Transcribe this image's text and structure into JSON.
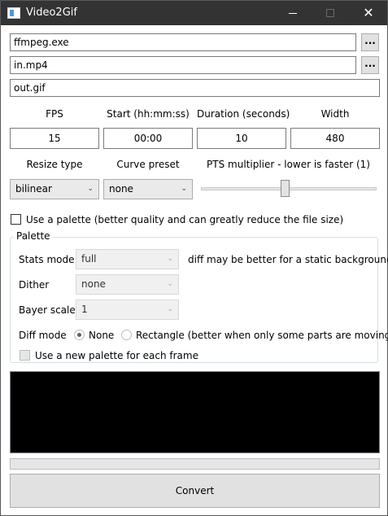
{
  "window": {
    "title": "Video2Gif",
    "minimize_glyph": "",
    "maximize_glyph": "",
    "close_glyph": "✕"
  },
  "paths": {
    "ffmpeg": "ffmpeg.exe",
    "input": "in.mp4",
    "output": "out.gif",
    "browse_label": "..."
  },
  "params": {
    "fps_label": "FPS",
    "start_label": "Start (hh:mm:ss)",
    "duration_label": "Duration (seconds)",
    "width_label": "Width",
    "fps_value": "15",
    "start_value": "00:00",
    "duration_value": "10",
    "width_value": "480"
  },
  "options": {
    "resize_label": "Resize type",
    "curve_label": "Curve preset",
    "pts_label": "PTS multiplier - lower is faster (1)",
    "resize_value": "bilinear",
    "curve_value": "none",
    "pts_slider_fraction": 0.48,
    "dropdown_arrow": "⌄"
  },
  "use_palette": {
    "label": "Use a palette (better quality and can greatly reduce the file size)",
    "checked": false
  },
  "palette": {
    "title": "Palette",
    "stats_mode_label": "Stats mode",
    "stats_mode_value": "full",
    "stats_hint": "diff may be better for a static background",
    "dither_label": "Dither",
    "dither_value": "none",
    "bayer_label": "Bayer scale",
    "bayer_value": "1",
    "diff_mode_label": "Diff mode",
    "diff_none_label": "None",
    "diff_rect_label": "Rectangle (better when only some parts are moving)",
    "new_palette_label": "Use a new palette for each frame"
  },
  "progress": {
    "fraction": 0
  },
  "convert_label": "Convert",
  "colors": {
    "titlebar": "#333333",
    "preview_bg": "#000000",
    "button_bg": "#e1e1e1"
  }
}
